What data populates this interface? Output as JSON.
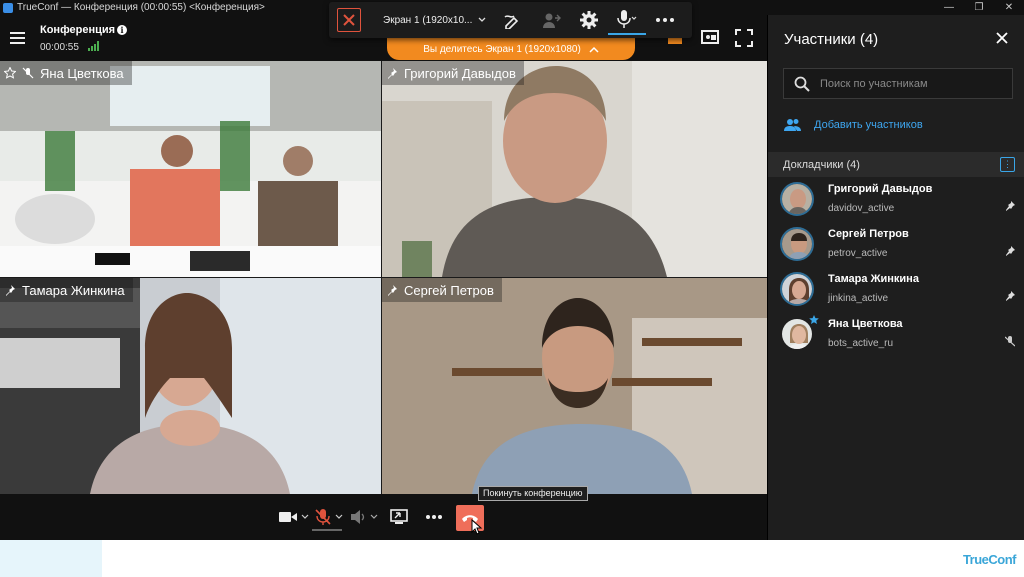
{
  "window": {
    "title": "TrueConf — Конференция (00:00:55) <Конференция>",
    "min_label": "—",
    "max_label": "❐",
    "close_label": "✕"
  },
  "header": {
    "conference_name": "Конференция",
    "elapsed": "00:00:55"
  },
  "share_toolbar": {
    "screen_label": "Экран 1 (1920x10...",
    "banner_text": "Вы делитесь Экран 1 (1920x1080)"
  },
  "tiles": [
    {
      "name": "Яна Цветкова",
      "icon": "star-icon",
      "bg": "#cfd8d2"
    },
    {
      "name": "Григорий Давыдов",
      "icon": "pin-icon",
      "bg": "#d9d6cf"
    },
    {
      "name": "Тамара Жинкина",
      "icon": "pin-icon",
      "bg": "#c9cdd2"
    },
    {
      "name": "Сергей Петров",
      "icon": "pin-icon",
      "bg": "#b7a99a"
    }
  ],
  "tooltip": "Покинуть конференцию",
  "panel": {
    "title": "Участники (4)",
    "search_placeholder": "Поиск по участникам",
    "add_label": "Добавить участников",
    "section_label": "Докладчики (4)",
    "participants": [
      {
        "name": "Григорий Давыдов",
        "status": "davidov_active",
        "icon": "pin-icon"
      },
      {
        "name": "Сергей Петров",
        "status": "petrov_active",
        "icon": "pin-icon"
      },
      {
        "name": "Тамара Жинкина",
        "status": "jinkina_active",
        "icon": "pin-icon"
      },
      {
        "name": "Яна Цветкова",
        "status": "bots_active_ru",
        "icon": "mute-icon"
      }
    ]
  },
  "brand": "TrueConf",
  "colors": {
    "accent_blue": "#3aa6e8",
    "share_orange": "#f28a1f",
    "hangup_red": "#ef6e5a",
    "stop_red": "#e0533d",
    "signal_green": "#4caf50"
  }
}
